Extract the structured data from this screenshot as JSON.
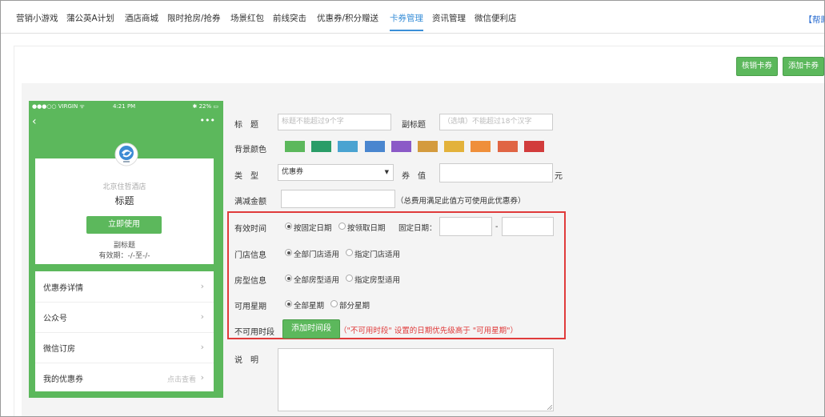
{
  "nav": {
    "items": [
      {
        "label": "营销小游戏",
        "active": false
      },
      {
        "label": "蒲公英A计划",
        "active": false
      },
      {
        "label": "酒店商城",
        "active": false
      },
      {
        "label": "限时抢房/抢券",
        "active": false
      },
      {
        "label": "场景红包",
        "active": false
      },
      {
        "label": "前线突击",
        "active": false
      },
      {
        "label": "优惠券/积分赠送",
        "active": false
      },
      {
        "label": "卡券管理",
        "active": true
      },
      {
        "label": "资讯管理",
        "active": false
      },
      {
        "label": "微信便利店",
        "active": false
      }
    ],
    "help": "【帮助"
  },
  "toolbar": {
    "verify_label": "核销卡券",
    "add_label": "添加卡券"
  },
  "phone": {
    "carrier": "●●●○○ VIRGIN ᯤ",
    "time": "4:21 PM",
    "battery": "✱ 22% ▭",
    "back": "‹",
    "more": "•••",
    "hotel_name": "北京住哲酒店",
    "title": "标题",
    "use_button": "立即使用",
    "subtitle": "副标题",
    "validity": "有效期：-/-至-/-",
    "list": [
      {
        "label": "优惠券详情",
        "hint": ""
      },
      {
        "label": "公众号",
        "hint": ""
      },
      {
        "label": "微信订房",
        "hint": ""
      },
      {
        "label": "我的优惠券",
        "hint": "点击查看"
      }
    ],
    "chevron": "›"
  },
  "form": {
    "title_label": "标　题",
    "title_placeholder": "标题不能超过9个字",
    "subtitle_label": "副标题",
    "subtitle_placeholder": "（选填）不能超过18个汉字",
    "bg_label": "背景颜色",
    "colors": [
      "#5cb85c",
      "#2a9d68",
      "#4aa3d1",
      "#4a86cf",
      "#8b5ac7",
      "#d49b3e",
      "#e3b23b",
      "#ef8f3a",
      "#e06544",
      "#d23c3c"
    ],
    "type_label": "类　型",
    "type_value": "优惠券",
    "type_arrow": "▼",
    "value_label": "券　值",
    "value_unit": "元",
    "min_label": "满减金额",
    "min_hint": "（总费用满足此值方可使用此优惠券）",
    "validity_label": "有效时间",
    "validity_opt1": "按固定日期",
    "validity_opt2": "按领取日期",
    "fixed_date_label": "固定日期：",
    "date_sep": "-",
    "store_label": "门店信息",
    "store_opt1": "全部门店适用",
    "store_opt2": "指定门店适用",
    "room_label": "房型信息",
    "room_opt1": "全部房型适用",
    "room_opt2": "指定房型适用",
    "week_label": "可用星期",
    "week_opt1": "全部星期",
    "week_opt2": "部分星期",
    "unavail_label": "不可用时段",
    "add_period_button": "添加时间段",
    "unavail_warning": "（\"不可用时段\" 设置的日期优先级高于 \"可用星期\"）",
    "desc_label": "说　明"
  }
}
